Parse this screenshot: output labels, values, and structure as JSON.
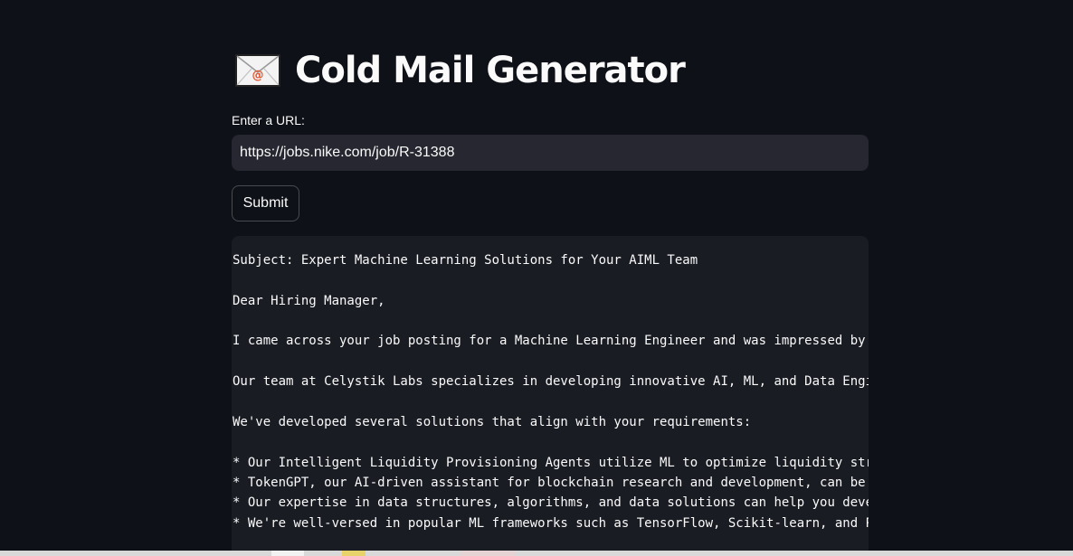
{
  "app": {
    "title": "Cold Mail Generator",
    "title_icon": "envelope-icon"
  },
  "form": {
    "url_label": "Enter a URL:",
    "url_value": "https://jobs.nike.com/job/R-31388",
    "submit_label": "Submit"
  },
  "email": {
    "lines": [
      "Subject: Expert Machine Learning Solutions for Your AIML Team",
      "Dear Hiring Manager,",
      "I came across your job posting for a Machine Learning Engineer and was impressed by",
      "Our team at Celystik Labs specializes in developing innovative AI, ML, and Data Engi",
      "We've developed several solutions that align with your requirements:",
      "* Our Intelligent Liquidity Provisioning Agents utilize ML to optimize liquidity str",
      "* TokenGPT, our AI-driven assistant for blockchain research and development, can be",
      "* Our expertise in data structures, algorithms, and data solutions can help you deve",
      "* We're well-versed in popular ML frameworks such as TensorFlow, Scikit-learn, and P"
    ]
  },
  "colors": {
    "background": "#0e1117",
    "input_background": "#262730",
    "code_background": "#1a1c24",
    "text": "#fafafa",
    "envelope_accent": "#e2552f"
  }
}
